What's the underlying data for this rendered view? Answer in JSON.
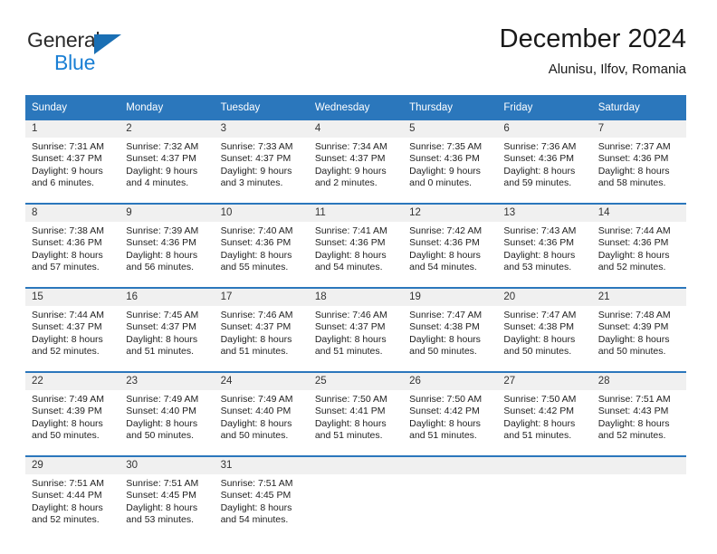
{
  "brand": {
    "name_part1": "General",
    "name_part2": "Blue",
    "logo_icon": "blue-triangle-icon",
    "color_dark": "#2b2b2b",
    "color_blue": "#1a7fd4"
  },
  "header": {
    "title": "December 2024",
    "location": "Alunisu, Ilfov, Romania"
  },
  "theme": {
    "header_bg": "#2b77bc",
    "header_text": "#ffffff",
    "daynum_bg": "#f0f0f0",
    "row_divider": "#2b77bc",
    "body_text": "#222222"
  },
  "calendar": {
    "weekdays": [
      "Sunday",
      "Monday",
      "Tuesday",
      "Wednesday",
      "Thursday",
      "Friday",
      "Saturday"
    ],
    "weeks": [
      [
        {
          "day": "1",
          "sunrise": "Sunrise: 7:31 AM",
          "sunset": "Sunset: 4:37 PM",
          "daylight": "Daylight: 9 hours and 6 minutes."
        },
        {
          "day": "2",
          "sunrise": "Sunrise: 7:32 AM",
          "sunset": "Sunset: 4:37 PM",
          "daylight": "Daylight: 9 hours and 4 minutes."
        },
        {
          "day": "3",
          "sunrise": "Sunrise: 7:33 AM",
          "sunset": "Sunset: 4:37 PM",
          "daylight": "Daylight: 9 hours and 3 minutes."
        },
        {
          "day": "4",
          "sunrise": "Sunrise: 7:34 AM",
          "sunset": "Sunset: 4:37 PM",
          "daylight": "Daylight: 9 hours and 2 minutes."
        },
        {
          "day": "5",
          "sunrise": "Sunrise: 7:35 AM",
          "sunset": "Sunset: 4:36 PM",
          "daylight": "Daylight: 9 hours and 0 minutes."
        },
        {
          "day": "6",
          "sunrise": "Sunrise: 7:36 AM",
          "sunset": "Sunset: 4:36 PM",
          "daylight": "Daylight: 8 hours and 59 minutes."
        },
        {
          "day": "7",
          "sunrise": "Sunrise: 7:37 AM",
          "sunset": "Sunset: 4:36 PM",
          "daylight": "Daylight: 8 hours and 58 minutes."
        }
      ],
      [
        {
          "day": "8",
          "sunrise": "Sunrise: 7:38 AM",
          "sunset": "Sunset: 4:36 PM",
          "daylight": "Daylight: 8 hours and 57 minutes."
        },
        {
          "day": "9",
          "sunrise": "Sunrise: 7:39 AM",
          "sunset": "Sunset: 4:36 PM",
          "daylight": "Daylight: 8 hours and 56 minutes."
        },
        {
          "day": "10",
          "sunrise": "Sunrise: 7:40 AM",
          "sunset": "Sunset: 4:36 PM",
          "daylight": "Daylight: 8 hours and 55 minutes."
        },
        {
          "day": "11",
          "sunrise": "Sunrise: 7:41 AM",
          "sunset": "Sunset: 4:36 PM",
          "daylight": "Daylight: 8 hours and 54 minutes."
        },
        {
          "day": "12",
          "sunrise": "Sunrise: 7:42 AM",
          "sunset": "Sunset: 4:36 PM",
          "daylight": "Daylight: 8 hours and 54 minutes."
        },
        {
          "day": "13",
          "sunrise": "Sunrise: 7:43 AM",
          "sunset": "Sunset: 4:36 PM",
          "daylight": "Daylight: 8 hours and 53 minutes."
        },
        {
          "day": "14",
          "sunrise": "Sunrise: 7:44 AM",
          "sunset": "Sunset: 4:36 PM",
          "daylight": "Daylight: 8 hours and 52 minutes."
        }
      ],
      [
        {
          "day": "15",
          "sunrise": "Sunrise: 7:44 AM",
          "sunset": "Sunset: 4:37 PM",
          "daylight": "Daylight: 8 hours and 52 minutes."
        },
        {
          "day": "16",
          "sunrise": "Sunrise: 7:45 AM",
          "sunset": "Sunset: 4:37 PM",
          "daylight": "Daylight: 8 hours and 51 minutes."
        },
        {
          "day": "17",
          "sunrise": "Sunrise: 7:46 AM",
          "sunset": "Sunset: 4:37 PM",
          "daylight": "Daylight: 8 hours and 51 minutes."
        },
        {
          "day": "18",
          "sunrise": "Sunrise: 7:46 AM",
          "sunset": "Sunset: 4:37 PM",
          "daylight": "Daylight: 8 hours and 51 minutes."
        },
        {
          "day": "19",
          "sunrise": "Sunrise: 7:47 AM",
          "sunset": "Sunset: 4:38 PM",
          "daylight": "Daylight: 8 hours and 50 minutes."
        },
        {
          "day": "20",
          "sunrise": "Sunrise: 7:47 AM",
          "sunset": "Sunset: 4:38 PM",
          "daylight": "Daylight: 8 hours and 50 minutes."
        },
        {
          "day": "21",
          "sunrise": "Sunrise: 7:48 AM",
          "sunset": "Sunset: 4:39 PM",
          "daylight": "Daylight: 8 hours and 50 minutes."
        }
      ],
      [
        {
          "day": "22",
          "sunrise": "Sunrise: 7:49 AM",
          "sunset": "Sunset: 4:39 PM",
          "daylight": "Daylight: 8 hours and 50 minutes."
        },
        {
          "day": "23",
          "sunrise": "Sunrise: 7:49 AM",
          "sunset": "Sunset: 4:40 PM",
          "daylight": "Daylight: 8 hours and 50 minutes."
        },
        {
          "day": "24",
          "sunrise": "Sunrise: 7:49 AM",
          "sunset": "Sunset: 4:40 PM",
          "daylight": "Daylight: 8 hours and 50 minutes."
        },
        {
          "day": "25",
          "sunrise": "Sunrise: 7:50 AM",
          "sunset": "Sunset: 4:41 PM",
          "daylight": "Daylight: 8 hours and 51 minutes."
        },
        {
          "day": "26",
          "sunrise": "Sunrise: 7:50 AM",
          "sunset": "Sunset: 4:42 PM",
          "daylight": "Daylight: 8 hours and 51 minutes."
        },
        {
          "day": "27",
          "sunrise": "Sunrise: 7:50 AM",
          "sunset": "Sunset: 4:42 PM",
          "daylight": "Daylight: 8 hours and 51 minutes."
        },
        {
          "day": "28",
          "sunrise": "Sunrise: 7:51 AM",
          "sunset": "Sunset: 4:43 PM",
          "daylight": "Daylight: 8 hours and 52 minutes."
        }
      ],
      [
        {
          "day": "29",
          "sunrise": "Sunrise: 7:51 AM",
          "sunset": "Sunset: 4:44 PM",
          "daylight": "Daylight: 8 hours and 52 minutes."
        },
        {
          "day": "30",
          "sunrise": "Sunrise: 7:51 AM",
          "sunset": "Sunset: 4:45 PM",
          "daylight": "Daylight: 8 hours and 53 minutes."
        },
        {
          "day": "31",
          "sunrise": "Sunrise: 7:51 AM",
          "sunset": "Sunset: 4:45 PM",
          "daylight": "Daylight: 8 hours and 54 minutes."
        },
        {
          "day": "",
          "sunrise": "",
          "sunset": "",
          "daylight": ""
        },
        {
          "day": "",
          "sunrise": "",
          "sunset": "",
          "daylight": ""
        },
        {
          "day": "",
          "sunrise": "",
          "sunset": "",
          "daylight": ""
        },
        {
          "day": "",
          "sunrise": "",
          "sunset": "",
          "daylight": ""
        }
      ]
    ]
  }
}
